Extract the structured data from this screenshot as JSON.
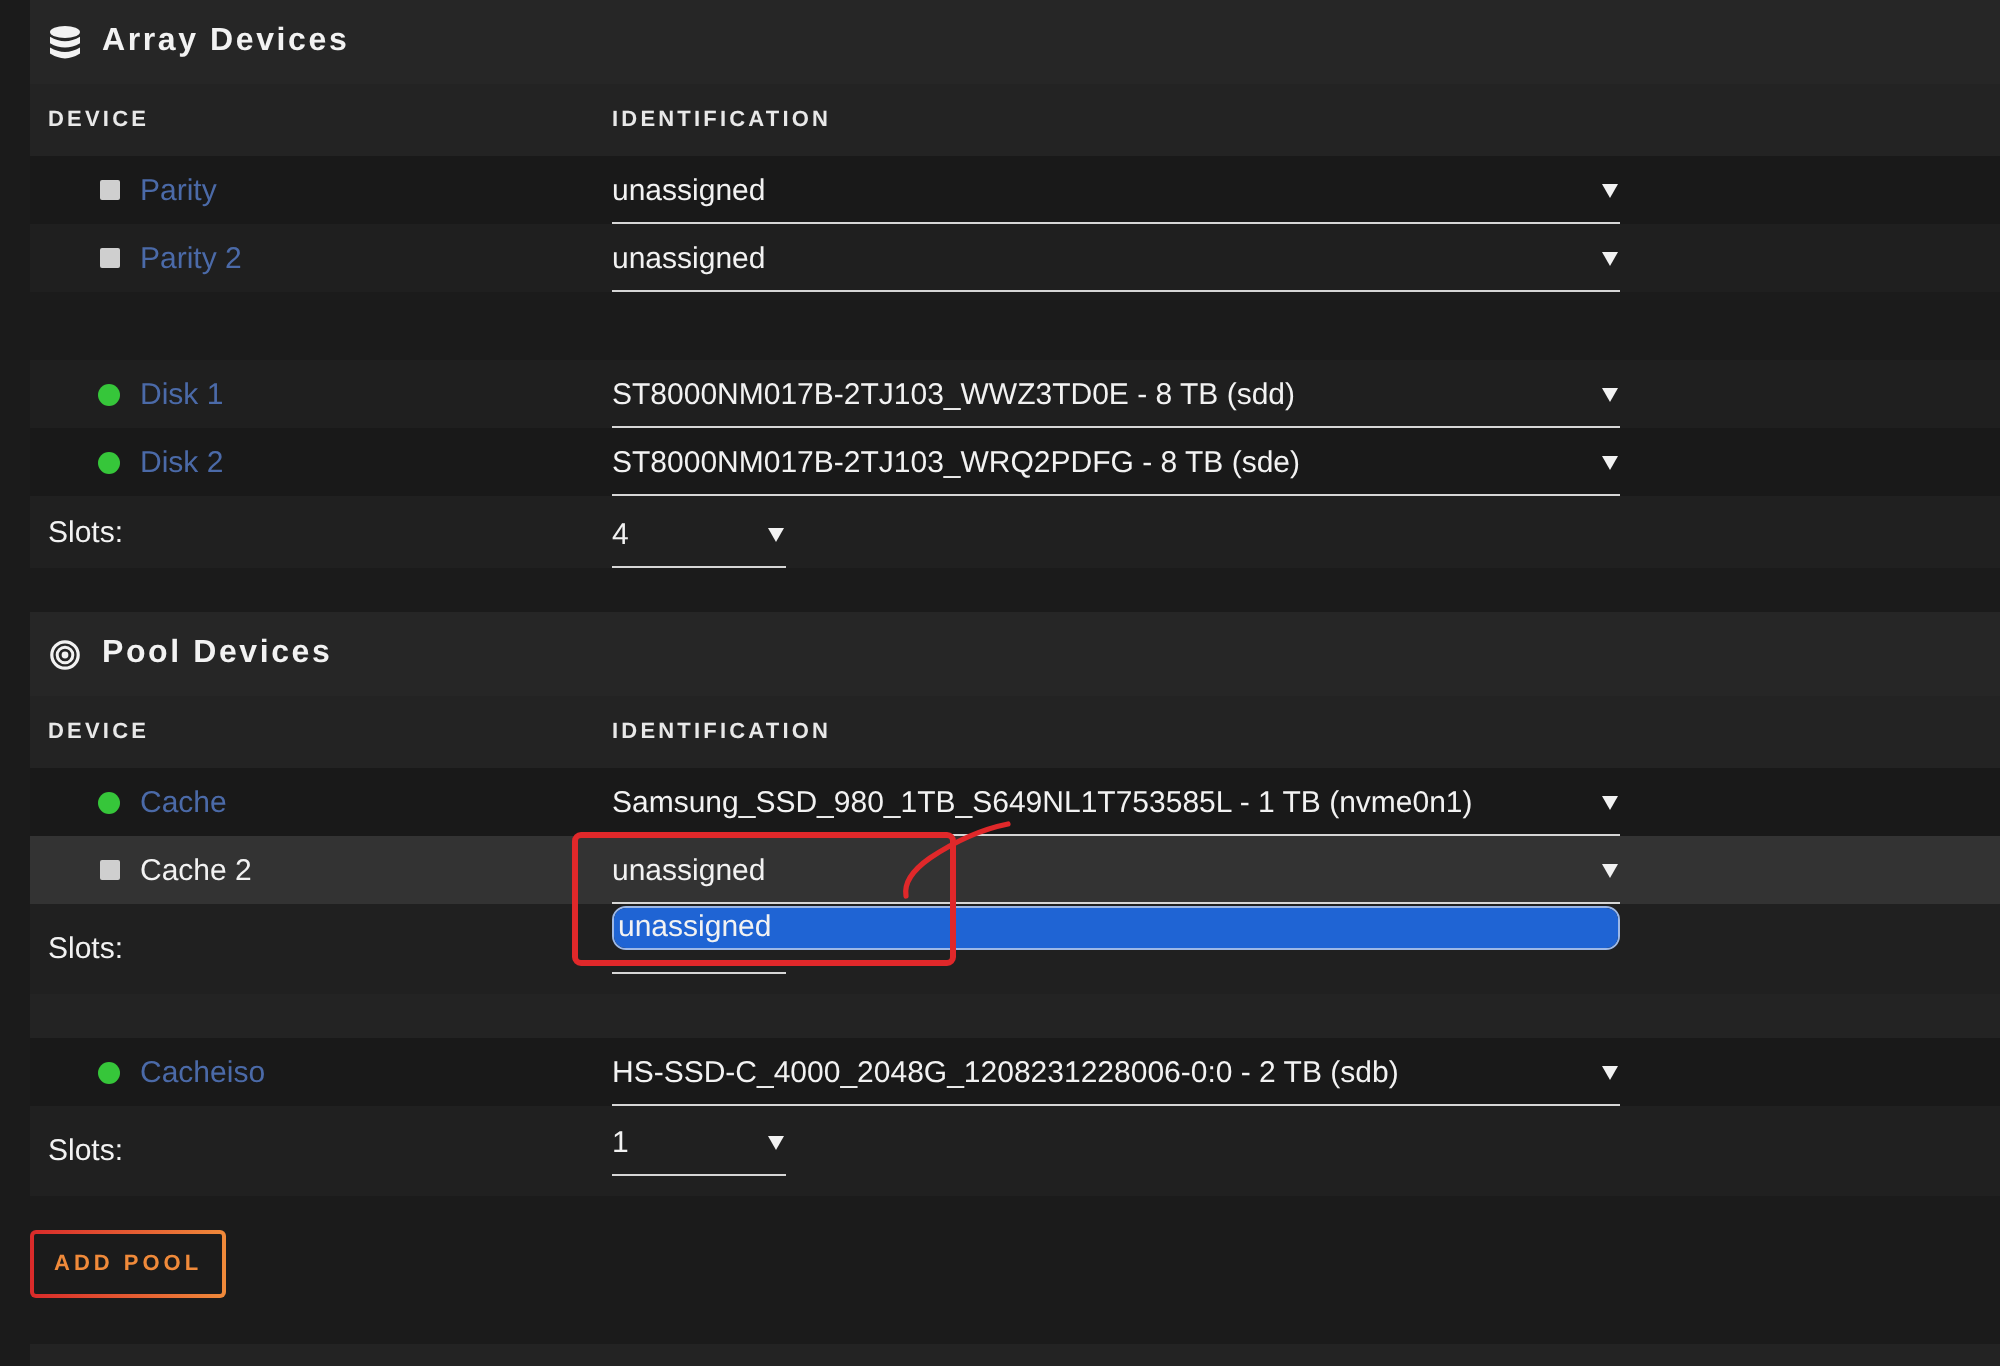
{
  "sections": [
    {
      "kind": "array",
      "title": "Array Devices",
      "columns": [
        "DEVICE",
        "IDENTIFICATION"
      ],
      "groups": [
        {
          "devices": [
            {
              "name": "Parity",
              "kind": "empty",
              "identification": "unassigned",
              "active": false
            },
            {
              "name": "Parity 2",
              "kind": "empty",
              "identification": "unassigned",
              "active": false
            }
          ]
        },
        {
          "devices": [
            {
              "name": "Disk 1",
              "kind": "online",
              "identification": "ST8000NM017B-2TJ103_WWZ3TD0E - 8 TB (sdd)",
              "active": false
            },
            {
              "name": "Disk 2",
              "kind": "online",
              "identification": "ST8000NM017B-2TJ103_WRQ2PDFG - 8 TB (sde)",
              "active": false
            }
          ],
          "slots": {
            "label": "Slots:",
            "value": "4"
          }
        }
      ]
    },
    {
      "kind": "pool",
      "title": "Pool Devices",
      "columns": [
        "DEVICE",
        "IDENTIFICATION"
      ],
      "groups": [
        {
          "devices": [
            {
              "name": "Cache",
              "kind": "online",
              "identification": "Samsung_SSD_980_1TB_S649NL1T753585L - 1 TB (nvme0n1)",
              "active": false
            },
            {
              "name": "Cache 2",
              "kind": "empty",
              "identification": "unassigned",
              "active": true,
              "dropdown": {
                "options": [
                  {
                    "label": "unassigned",
                    "selected": true
                  }
                ]
              }
            }
          ],
          "slots": {
            "label": "Slots:"
          }
        },
        {
          "devices": [
            {
              "name": "Cacheiso",
              "kind": "online",
              "identification": "HS-SSD-C_4000_2048G_1208231228006-0:0 - 2 TB (sdb)",
              "active": false
            }
          ],
          "slots": {
            "label": "Slots:",
            "value": "1"
          }
        }
      ]
    }
  ],
  "buttons": [
    {
      "label": "ADD POOL"
    }
  ],
  "markup": {
    "frame": true,
    "stroke": true
  }
}
